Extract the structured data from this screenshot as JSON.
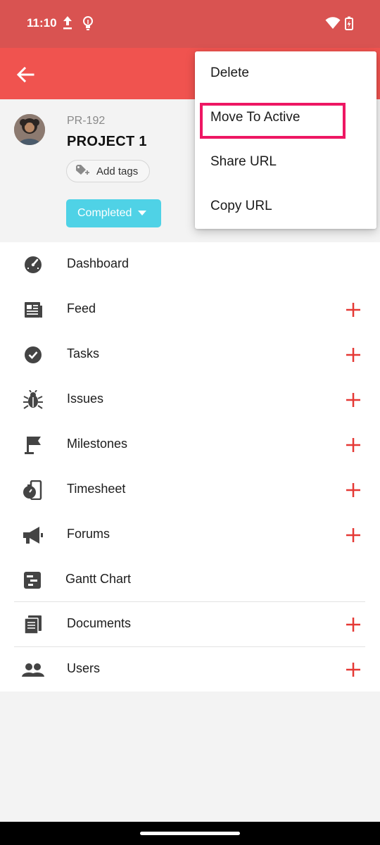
{
  "status_bar": {
    "time": "11:10",
    "icons": [
      "upload-icon",
      "lightbulb-icon",
      "wifi-icon",
      "battery-charging-icon"
    ]
  },
  "app_bar": {
    "back_icon": "arrow-back-icon",
    "color": "#f0534f"
  },
  "project": {
    "id": "PR-192",
    "name": "PROJECT 1",
    "add_tags_label": "Add tags",
    "status_label": "Completed",
    "status_color": "#4fd2e6"
  },
  "menu": {
    "items": [
      {
        "label": "Dashboard",
        "icon": "speedometer-icon",
        "has_add": false
      },
      {
        "label": "Feed",
        "icon": "newspaper-icon",
        "has_add": true
      },
      {
        "label": "Tasks",
        "icon": "check-circle-icon",
        "has_add": true
      },
      {
        "label": "Issues",
        "icon": "bug-icon",
        "has_add": true
      },
      {
        "label": "Milestones",
        "icon": "flag-icon",
        "has_add": true
      },
      {
        "label": "Timesheet",
        "icon": "stopwatch-icon",
        "has_add": true
      },
      {
        "label": "Forums",
        "icon": "megaphone-icon",
        "has_add": true
      },
      {
        "label": "Gantt Chart",
        "icon": "gantt-icon",
        "has_add": false
      },
      {
        "label": "Documents",
        "icon": "documents-icon",
        "has_add": true
      },
      {
        "label": "Users",
        "icon": "users-icon",
        "has_add": true
      }
    ],
    "add_color": "#e53935"
  },
  "popup_menu": {
    "items": [
      {
        "label": "Delete"
      },
      {
        "label": "Move To Active"
      },
      {
        "label": "Share URL"
      },
      {
        "label": "Copy URL"
      }
    ],
    "highlight_color": "#ee1763"
  }
}
